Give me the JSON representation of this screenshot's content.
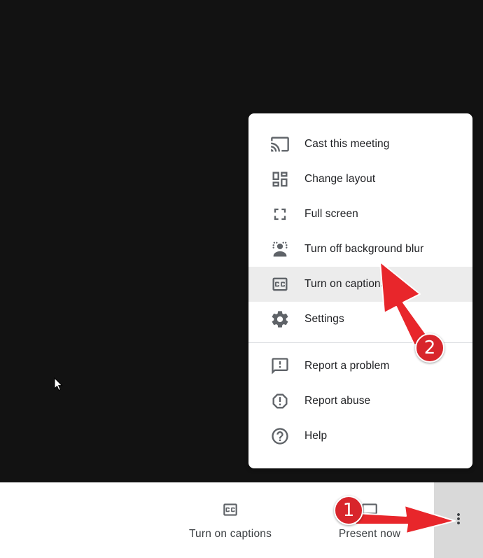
{
  "menu": {
    "items": [
      {
        "label": "Cast this meeting",
        "icon": "cast-icon"
      },
      {
        "label": "Change layout",
        "icon": "layout-icon"
      },
      {
        "label": "Full screen",
        "icon": "fullscreen-icon"
      },
      {
        "label": "Turn off background blur",
        "icon": "background-blur-icon"
      },
      {
        "label": "Turn on captions",
        "icon": "captions-icon",
        "highlighted": true
      },
      {
        "label": "Settings",
        "icon": "gear-icon"
      }
    ],
    "secondary_items": [
      {
        "label": "Report a problem",
        "icon": "report-problem-icon"
      },
      {
        "label": "Report abuse",
        "icon": "report-abuse-icon"
      },
      {
        "label": "Help",
        "icon": "help-icon"
      }
    ]
  },
  "bottom_bar": {
    "captions_label": "Turn on captions",
    "present_label": "Present now",
    "more_icon": "more-vert-icon"
  },
  "annotations": {
    "badge_1": "1",
    "badge_2": "2"
  },
  "colors": {
    "background": "#121212",
    "menu_highlight": "#ececec",
    "annotation_red": "#d8252b",
    "more_button_bg": "#d9d9d9"
  }
}
